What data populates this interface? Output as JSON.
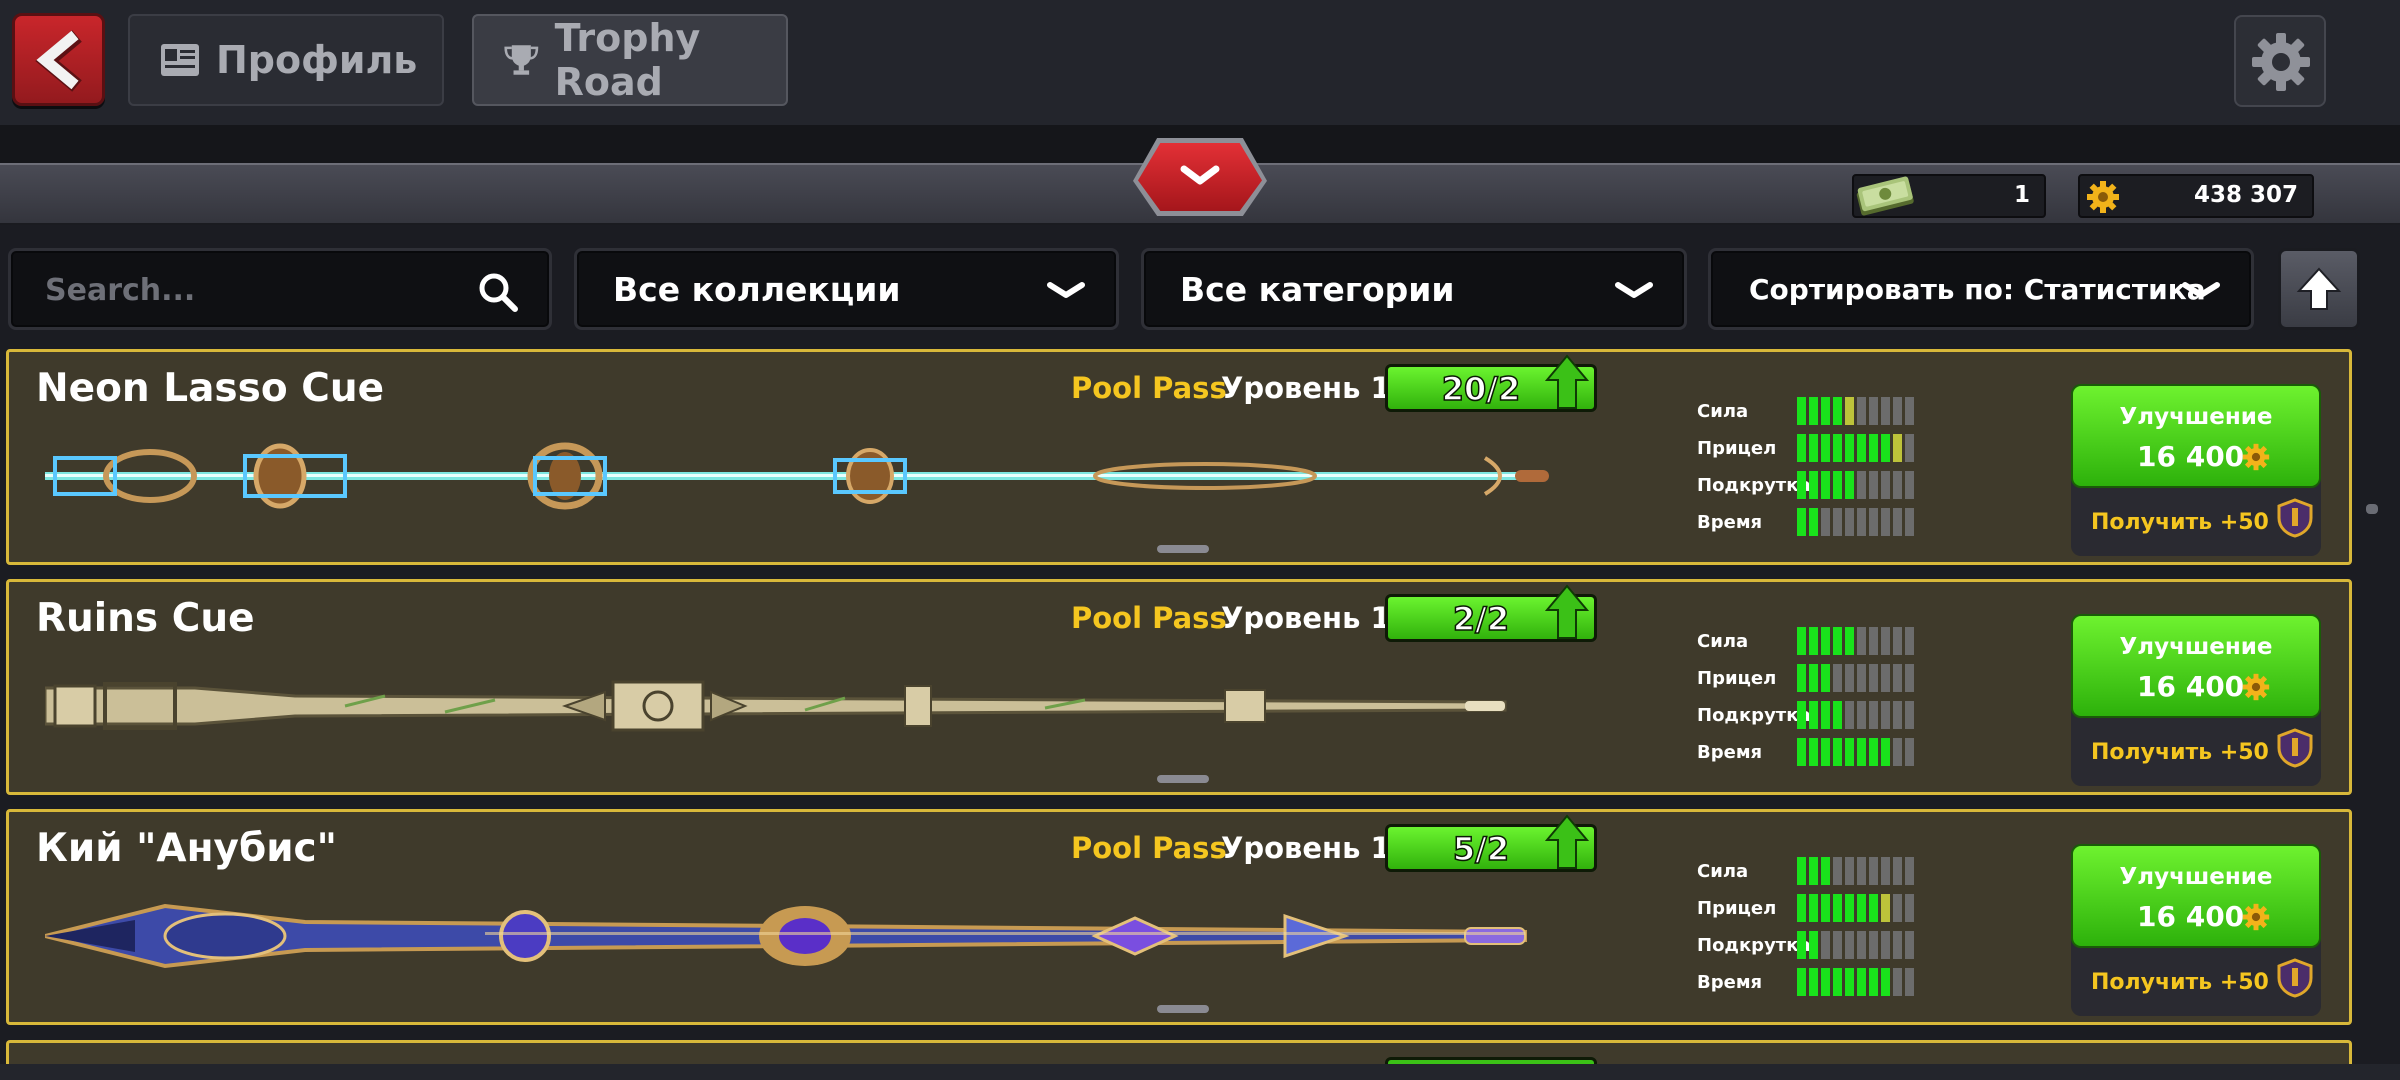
{
  "header": {
    "back_icon": "back-arrow-icon",
    "tabs": [
      {
        "label": "Профиль",
        "icon": "profile-card-icon"
      },
      {
        "label": "Trophy Road",
        "icon": "trophy-icon"
      }
    ],
    "settings_icon": "gear-icon"
  },
  "currencies": {
    "cash": {
      "value": "1",
      "icon": "cash-icon"
    },
    "coins": {
      "value": "438 307",
      "icon": "coin-icon"
    }
  },
  "filters": {
    "search_placeholder": "Search...",
    "collections": "Все коллекции",
    "categories": "Все категории",
    "sort": "Сортировать по: Статистика",
    "sort_direction_icon": "arrow-up-icon"
  },
  "stat_labels": [
    "Сила",
    "Прицел",
    "Подкрутка",
    "Время"
  ],
  "cues": [
    {
      "name": "Neon Lasso Cue",
      "source": "Pool Pass",
      "level": "Уровень 1",
      "pieces": "20/2",
      "stats": [
        4,
        8,
        5,
        2
      ],
      "upgrade_label": "Улучшение",
      "upgrade_cost": "16 400",
      "reward_label": "Получить +50"
    },
    {
      "name": "Ruins Cue",
      "source": "Pool Pass",
      "level": "Уровень 1",
      "pieces": "2/2",
      "stats": [
        5,
        3,
        4,
        8
      ],
      "upgrade_label": "Улучшение",
      "upgrade_cost": "16 400",
      "reward_label": "Получить +50"
    },
    {
      "name": "Кий \"Анубис\"",
      "source": "Pool Pass",
      "level": "Уровень 1",
      "pieces": "5/2",
      "stats": [
        3,
        7,
        2,
        8
      ],
      "upgrade_label": "Улучшение",
      "upgrade_cost": "16 400",
      "reward_label": "Получить +50"
    }
  ],
  "colors": {
    "accent_green": "#33c40f",
    "pass_yellow": "#f5c620",
    "card_border": "#d8b83a",
    "back_red": "#c9262b"
  }
}
